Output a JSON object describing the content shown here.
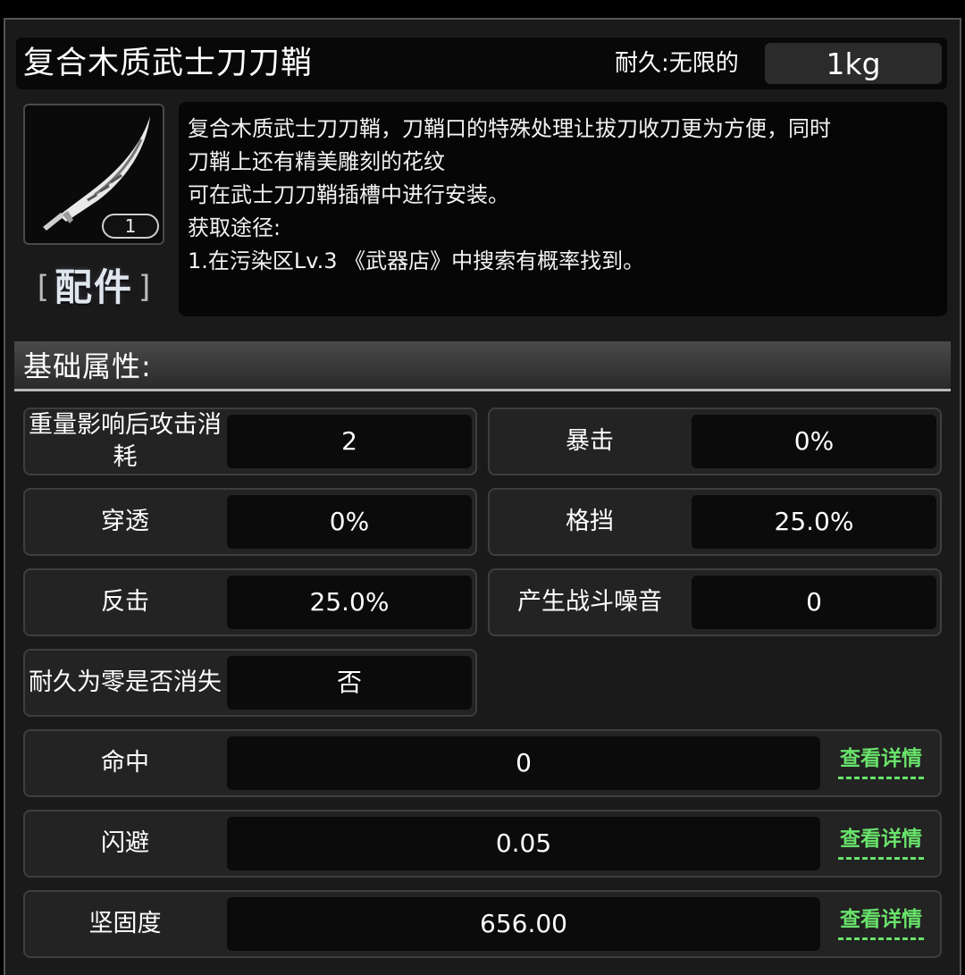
{
  "item": {
    "title": "复合木质武士刀刀鞘",
    "durability_label": "耐久:无限的",
    "weight": "1kg",
    "count": "1",
    "category_open": "[",
    "category": "配件",
    "category_close": "]",
    "icon": "katana-sheath-icon",
    "description_lines": [
      "复合木质武士刀刀鞘，刀鞘口的特殊处理让拔刀收刀更为方便，同时",
      "刀鞘上还有精美雕刻的花纹",
      "可在武士刀刀鞘插槽中进行安装。",
      "获取途径:",
      "1.在污染区Lv.3 《武器店》中搜索有概率找到。"
    ]
  },
  "section": {
    "title": "基础属性:"
  },
  "stats": [
    {
      "label": "重量影响后攻击消耗",
      "value": "2"
    },
    {
      "label": "暴击",
      "value": "0%"
    },
    {
      "label": "穿透",
      "value": "0%"
    },
    {
      "label": "格挡",
      "value": "25.0%"
    },
    {
      "label": "反击",
      "value": "25.0%"
    },
    {
      "label": "产生战斗噪音",
      "value": "0"
    },
    {
      "label": "耐久为零是否消失",
      "value": "否"
    }
  ],
  "wide_stats": [
    {
      "label": "命中",
      "value": "0",
      "link": "查看详情"
    },
    {
      "label": "闪避",
      "value": "0.05",
      "link": "查看详情"
    },
    {
      "label": "坚固度",
      "value": "656.00",
      "link": "查看详情"
    }
  ],
  "colors": {
    "link": "#69e36b",
    "panel": "#1a1a1a",
    "value_bg": "#0b0b0b"
  }
}
